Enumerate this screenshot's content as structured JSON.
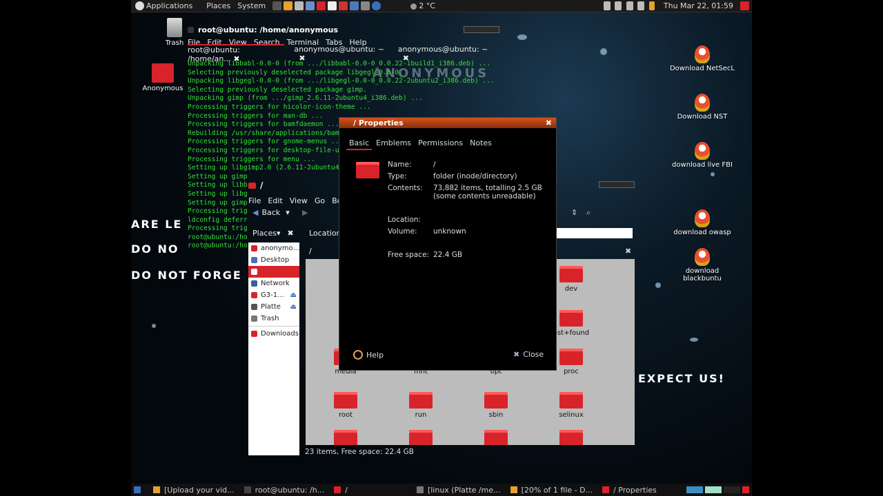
{
  "top_panel": {
    "menus": [
      "Applications",
      "Places",
      "System"
    ],
    "weather": "2 °C",
    "clock": "Thu Mar 22, 01:59"
  },
  "desktop_icons_left": [
    {
      "label": "Trash"
    },
    {
      "label": "Anonymous"
    }
  ],
  "desktop_icons_right": [
    {
      "label": "Download NetSecL"
    },
    {
      "label": "Download NST"
    },
    {
      "label": "download live FBI"
    },
    {
      "label": "download owasp"
    },
    {
      "label": "download blackbuntu"
    }
  ],
  "wallpaper_text": {
    "line1": "ARE LE",
    "line2": "DO NO",
    "line3": "DO NOT FORGE",
    "line4": "EXPECT US!",
    "logo": "ANONYMOUS"
  },
  "terminal": {
    "title": "root@ubuntu: /home/anonymous",
    "menu": [
      "File",
      "Edit",
      "View",
      "Search",
      "Terminal",
      "Tabs",
      "Help"
    ],
    "tabs": [
      "root@ubuntu: /home/an...",
      "anonymous@ubuntu: ~",
      "anonymous@ubuntu: ~"
    ],
    "lines": [
      "Unpacking libbabl-0.0-0 (from .../libbabl-0.0-0_0.0.22-1build1_i386.deb) ...",
      "Selecting previously deselected package libgegl-0.0-0.",
      "Unpacking libgegl-0.0-0 (from .../libgegl-0.0-0_0.0.22-2ubuntu2_i386.deb) ...",
      "Selecting previously deselected package gimp.",
      "Unpacking gimp (from .../gimp_2.6.11-2ubuntu4_i386.deb) ...",
      "Processing triggers for hicolor-icon-theme ...",
      "Processing triggers for man-db ...",
      "Processing triggers for bamfdaemon ...",
      "Rebuilding /usr/share/applications/bamf",
      "Processing triggers for gnome-menus ...",
      "Processing triggers for desktop-file-u",
      "Processing triggers for menu ...",
      "Setting up libgimp2.0 (2.6.11-2ubuntu4",
      "Setting up gimp",
      "Setting up libb",
      "Setting up libg",
      "Setting up gimp",
      "Processing trig",
      "ldconfig deferr",
      "Processing trig",
      "root@ubuntu:/ho",
      "root@ubuntu:/ho"
    ]
  },
  "file_manager": {
    "title": "/",
    "menu": [
      "File",
      "Edit",
      "View",
      "Go",
      "Bo"
    ],
    "back_label": "Back",
    "places_label": "Places",
    "location_label": "Location",
    "path": "/",
    "sidebar": [
      {
        "label": "anonymo...",
        "color": "#d9232a"
      },
      {
        "label": "Desktop",
        "color": "#4a6fb5"
      },
      {
        "label": "",
        "color": "#d9232a"
      },
      {
        "label": "Network",
        "color": "#3a5f9a"
      },
      {
        "label": "G3-1...",
        "color": "#d9232a"
      },
      {
        "label": "Platte",
        "color": "#555555"
      },
      {
        "label": "Trash",
        "color": "#777777"
      },
      {
        "label": "Downloads",
        "color": "#d9232a"
      }
    ],
    "folders": [
      {
        "label": "dev"
      },
      {
        "label": "ost+found"
      },
      {
        "label": "media"
      },
      {
        "label": "mnt"
      },
      {
        "label": "opt"
      },
      {
        "label": "proc"
      },
      {
        "label": "root"
      },
      {
        "label": "run"
      },
      {
        "label": "sbin"
      },
      {
        "label": "selinux"
      }
    ],
    "status": "23 items, Free space: 22.4 GB"
  },
  "properties": {
    "title": "/ Properties",
    "tabs": [
      "Basic",
      "Emblems",
      "Permissions",
      "Notes"
    ],
    "name_label": "Name:",
    "name_value": "/",
    "type_label": "Type:",
    "type_value": "folder (inode/directory)",
    "contents_label": "Contents:",
    "contents_value": "73,882 items, totalling 2.5 GB",
    "contents_note": "(some contents unreadable)",
    "location_label": "Location:",
    "location_value": "",
    "volume_label": "Volume:",
    "volume_value": "unknown",
    "free_label": "Free space:",
    "free_value": "22.4 GB",
    "help_label": "Help",
    "close_label": "Close"
  },
  "taskbar": [
    {
      "label": "[Upload your vid..."
    },
    {
      "label": "root@ubuntu: /h..."
    },
    {
      "label": "/"
    },
    {
      "label": "[linux (Platte /me..."
    },
    {
      "label": "[20% of 1 file - D..."
    },
    {
      "label": "/ Properties"
    }
  ],
  "colors": {
    "accent": "#d9232a",
    "terminal_text": "#37e037",
    "dialog_title": "#d6521c"
  }
}
